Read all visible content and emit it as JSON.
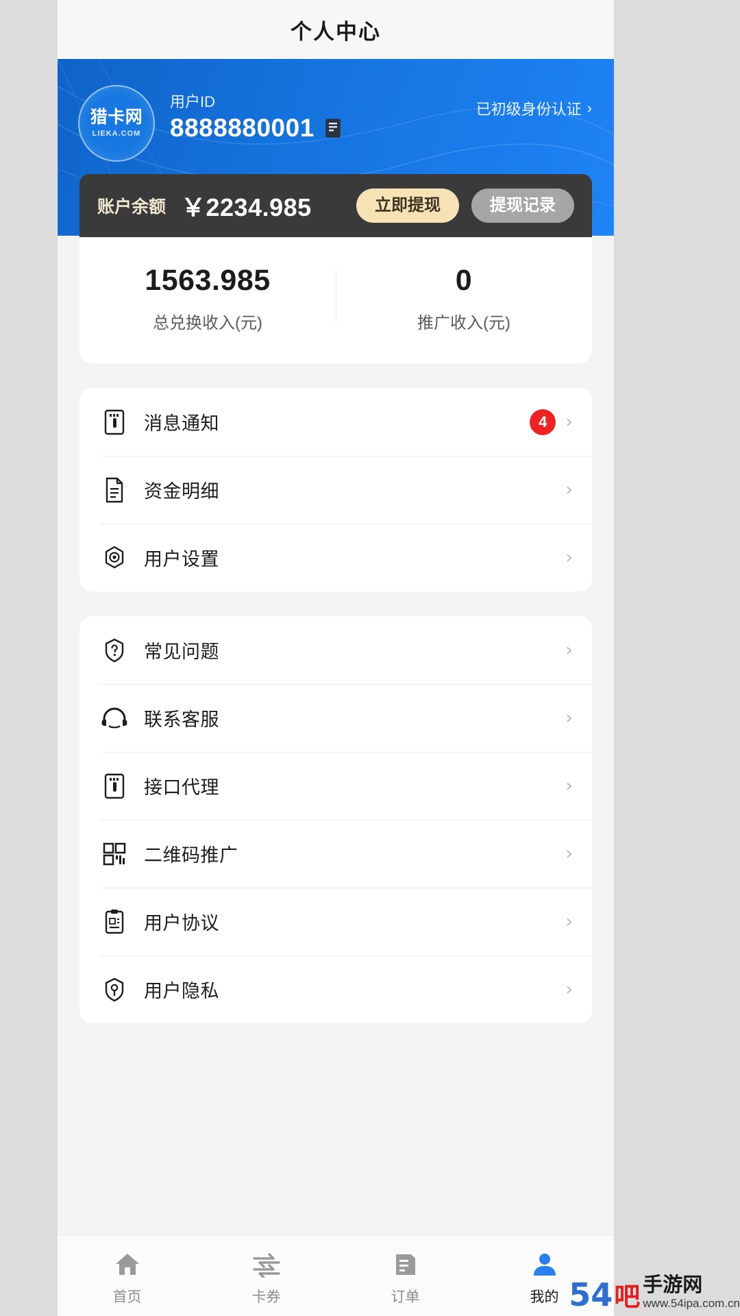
{
  "header": {
    "title": "个人中心"
  },
  "profile": {
    "logo_text": "猎卡网",
    "logo_sub": "LIEKA.COM",
    "uid_label": "用户ID",
    "uid_value": "8888880001",
    "copy_icon": "copy-icon",
    "cert_text": "已初级身份认证",
    "cert_chevron": "›"
  },
  "balance": {
    "label": "账户余额",
    "amount": "￥2234.985",
    "withdraw_label": "立即提现",
    "record_label": "提现记录"
  },
  "stats": [
    {
      "value": "1563.985",
      "caption": "总兑换收入(元)"
    },
    {
      "value": "0",
      "caption": "推广收入(元)"
    }
  ],
  "menu_group_1": [
    {
      "label": "消息通知",
      "icon": "notification-icon",
      "badge": "4",
      "chevron": "›"
    },
    {
      "label": "资金明细",
      "icon": "document-icon",
      "badge": "",
      "chevron": "›"
    },
    {
      "label": "用户设置",
      "icon": "settings-gear-icon",
      "badge": "",
      "chevron": "›"
    }
  ],
  "menu_group_2": [
    {
      "label": "常见问题",
      "icon": "question-shield-icon",
      "badge": "",
      "chevron": "›"
    },
    {
      "label": "联系客服",
      "icon": "headset-support-icon",
      "badge": "",
      "chevron": "›"
    },
    {
      "label": "接口代理",
      "icon": "api-card-icon",
      "badge": "",
      "chevron": "›"
    },
    {
      "label": "二维码推广",
      "icon": "qrcode-icon",
      "badge": "",
      "chevron": "›"
    },
    {
      "label": "用户协议",
      "icon": "agreement-icon",
      "badge": "",
      "chevron": "›"
    },
    {
      "label": "用户隐私",
      "icon": "privacy-shield-icon",
      "badge": "",
      "chevron": "›"
    }
  ],
  "tabbar": [
    {
      "label": "首页",
      "icon": "home-icon",
      "active": false
    },
    {
      "label": "卡券",
      "icon": "coupon-icon",
      "active": false
    },
    {
      "label": "订单",
      "icon": "order-list-icon",
      "active": false
    },
    {
      "label": "我的",
      "icon": "user-profile-icon",
      "active": true
    }
  ],
  "watermark": {
    "num": "54",
    "char": "吧",
    "top": "手游网",
    "bottom": "www.54ipa.com.cn"
  },
  "colors": {
    "hero_blue": "#1573dd",
    "accent_cream": "#f6e2b4",
    "badge_red": "#ee2222",
    "tab_active": "#2a7ff0"
  }
}
